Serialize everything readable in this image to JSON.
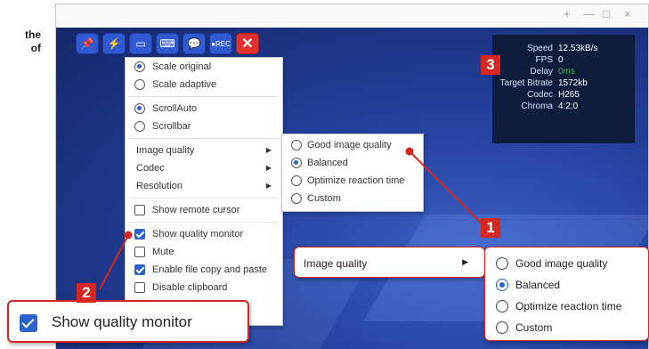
{
  "page_text": [
    "the",
    "of"
  ],
  "window": {
    "controls": [
      "+",
      "—",
      "□",
      "×"
    ]
  },
  "toolbar": {
    "buttons": [
      {
        "icon": "pin-icon",
        "glyph": "📌"
      },
      {
        "icon": "lightning-icon",
        "glyph": "⚡"
      },
      {
        "icon": "monitor-icon",
        "glyph": "▭"
      },
      {
        "icon": "keyboard-icon",
        "glyph": "⌨"
      },
      {
        "icon": "chat-icon",
        "glyph": "💬"
      },
      {
        "icon": "record-icon",
        "glyph": "●REC"
      },
      {
        "icon": "close-icon",
        "glyph": "✕"
      }
    ]
  },
  "main_menu": {
    "scale_original": "Scale original",
    "scale_adaptive": "Scale adaptive",
    "scroll_auto": "ScrollAuto",
    "scrollbar": "Scrollbar",
    "image_quality": "Image quality",
    "codec": "Codec",
    "resolution": "Resolution",
    "show_remote_cursor": "Show remote cursor",
    "show_quality_monitor": "Show quality monitor",
    "mute": "Mute",
    "enable_file_copy": "Enable file copy and paste",
    "disable_clipboard": "Disable clipboard"
  },
  "image_quality_menu": {
    "good": "Good image quality",
    "balanced": "Balanced",
    "optimize": "Optimize reaction time",
    "custom": "Custom"
  },
  "quality_monitor": {
    "rows": [
      {
        "key": "Speed",
        "value": "12.53kB/s"
      },
      {
        "key": "FPS",
        "value": "0"
      },
      {
        "key": "Delay",
        "value": "0ms"
      },
      {
        "key": "Target Bitrate",
        "value": "1572kb"
      },
      {
        "key": "Codec",
        "value": "H265"
      },
      {
        "key": "Chroma",
        "value": "4:2:0"
      }
    ]
  },
  "badges": {
    "one": "1",
    "two": "2",
    "three": "3"
  },
  "zoom_callouts": {
    "image_quality_label": "Image quality",
    "show_quality_monitor": "Show quality monitor"
  },
  "colors": {
    "accent_blue": "#2a62cc",
    "badge_red": "#d7261f",
    "desktop_blue": "#223f9a"
  }
}
